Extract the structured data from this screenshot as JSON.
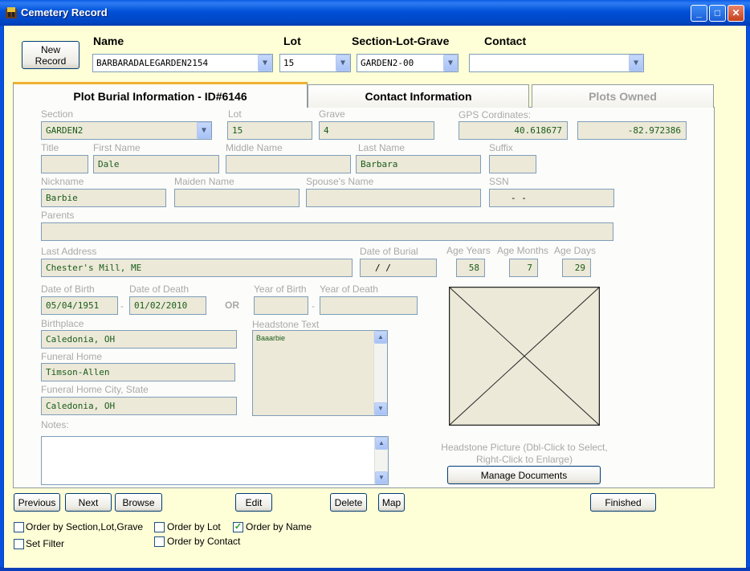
{
  "window": {
    "title": "Cemetery Record",
    "minimize": "_",
    "maximize": "□",
    "close": "✕"
  },
  "header": {
    "new_record": "New\nRecord",
    "name_label": "Name",
    "name_value": "BARBARADALEGARDEN2154",
    "lot_label": "Lot",
    "lot_value": "15",
    "slg_label": "Section-Lot-Grave",
    "slg_value": "GARDEN2-00",
    "contact_label": "Contact",
    "contact_value": ""
  },
  "tabs": [
    {
      "label": "Plot Burial Information - ID#6146"
    },
    {
      "label": "Contact Information"
    },
    {
      "label": "Plots Owned"
    }
  ],
  "fields": {
    "section": {
      "label": "Section",
      "value": "GARDEN2"
    },
    "lot": {
      "label": "Lot",
      "value": "15"
    },
    "grave": {
      "label": "Grave",
      "value": "4"
    },
    "gps": {
      "label": "GPS Cordinates:",
      "lat": "40.618677",
      "lon": "-82.972386"
    },
    "title": {
      "label": "Title",
      "value": ""
    },
    "first_name": {
      "label": "First Name",
      "value": "Dale"
    },
    "middle_name": {
      "label": "Middle Name",
      "value": ""
    },
    "last_name": {
      "label": "Last Name",
      "value": "Barbara"
    },
    "suffix": {
      "label": "Suffix",
      "value": ""
    },
    "nickname": {
      "label": "Nickname",
      "value": "Barbie"
    },
    "maiden_name": {
      "label": "Maiden Name",
      "value": ""
    },
    "spouse_name": {
      "label": "Spouse's Name",
      "value": ""
    },
    "ssn": {
      "label": "SSN",
      "value": "-  -"
    },
    "parents": {
      "label": "Parents",
      "value": ""
    },
    "last_address": {
      "label": "Last Address",
      "value": "Chester's Mill, ME"
    },
    "date_of_burial": {
      "label": "Date of Burial",
      "value": "/  /"
    },
    "age_years": {
      "label": "Age Years",
      "value": "58"
    },
    "age_months": {
      "label": "Age Months",
      "value": "7"
    },
    "age_days": {
      "label": "Age Days",
      "value": "29"
    },
    "date_of_birth": {
      "label": "Date of Birth",
      "value": "05/04/1951"
    },
    "date_of_death": {
      "label": "Date of Death",
      "value": "01/02/2010"
    },
    "or_label": "OR",
    "year_of_birth": {
      "label": "Year of Birth",
      "value": ""
    },
    "year_of_death": {
      "label": "Year of Death",
      "value": ""
    },
    "birthplace": {
      "label": "Birthplace",
      "value": "Caledonia, OH"
    },
    "funeral_home": {
      "label": "Funeral Home",
      "value": "Timson-Allen"
    },
    "funeral_city": {
      "label": "Funeral Home City, State",
      "value": "Caledonia, OH"
    },
    "headstone_text": {
      "label": "Headstone Text",
      "value": "Baaarbie"
    },
    "notes": {
      "label": "Notes:",
      "value": ""
    },
    "dash": "-"
  },
  "headstone": {
    "caption_line1": "Headstone Picture (Dbl-Click to Select,",
    "caption_line2": "Right-Click to Enlarge)",
    "manage_docs": "Manage Documents"
  },
  "buttons": {
    "previous": "Previous",
    "next": "Next",
    "browse": "Browse",
    "edit": "Edit",
    "delete": "Delete",
    "map": "Map",
    "finished": "Finished"
  },
  "options": {
    "order_slg": {
      "label": "Order by Section,Lot,Grave",
      "checked": false
    },
    "order_lot": {
      "label": "Order by Lot",
      "checked": false
    },
    "order_name": {
      "label": "Order by Name",
      "checked": true
    },
    "order_contact": {
      "label": "Order by Contact",
      "checked": false
    },
    "set_filter": {
      "label": "Set Filter",
      "checked": false
    }
  },
  "icons": {
    "scroll_up": "▲",
    "scroll_down": "▼",
    "combo_arrow": "▼",
    "checkmark": "✓"
  }
}
